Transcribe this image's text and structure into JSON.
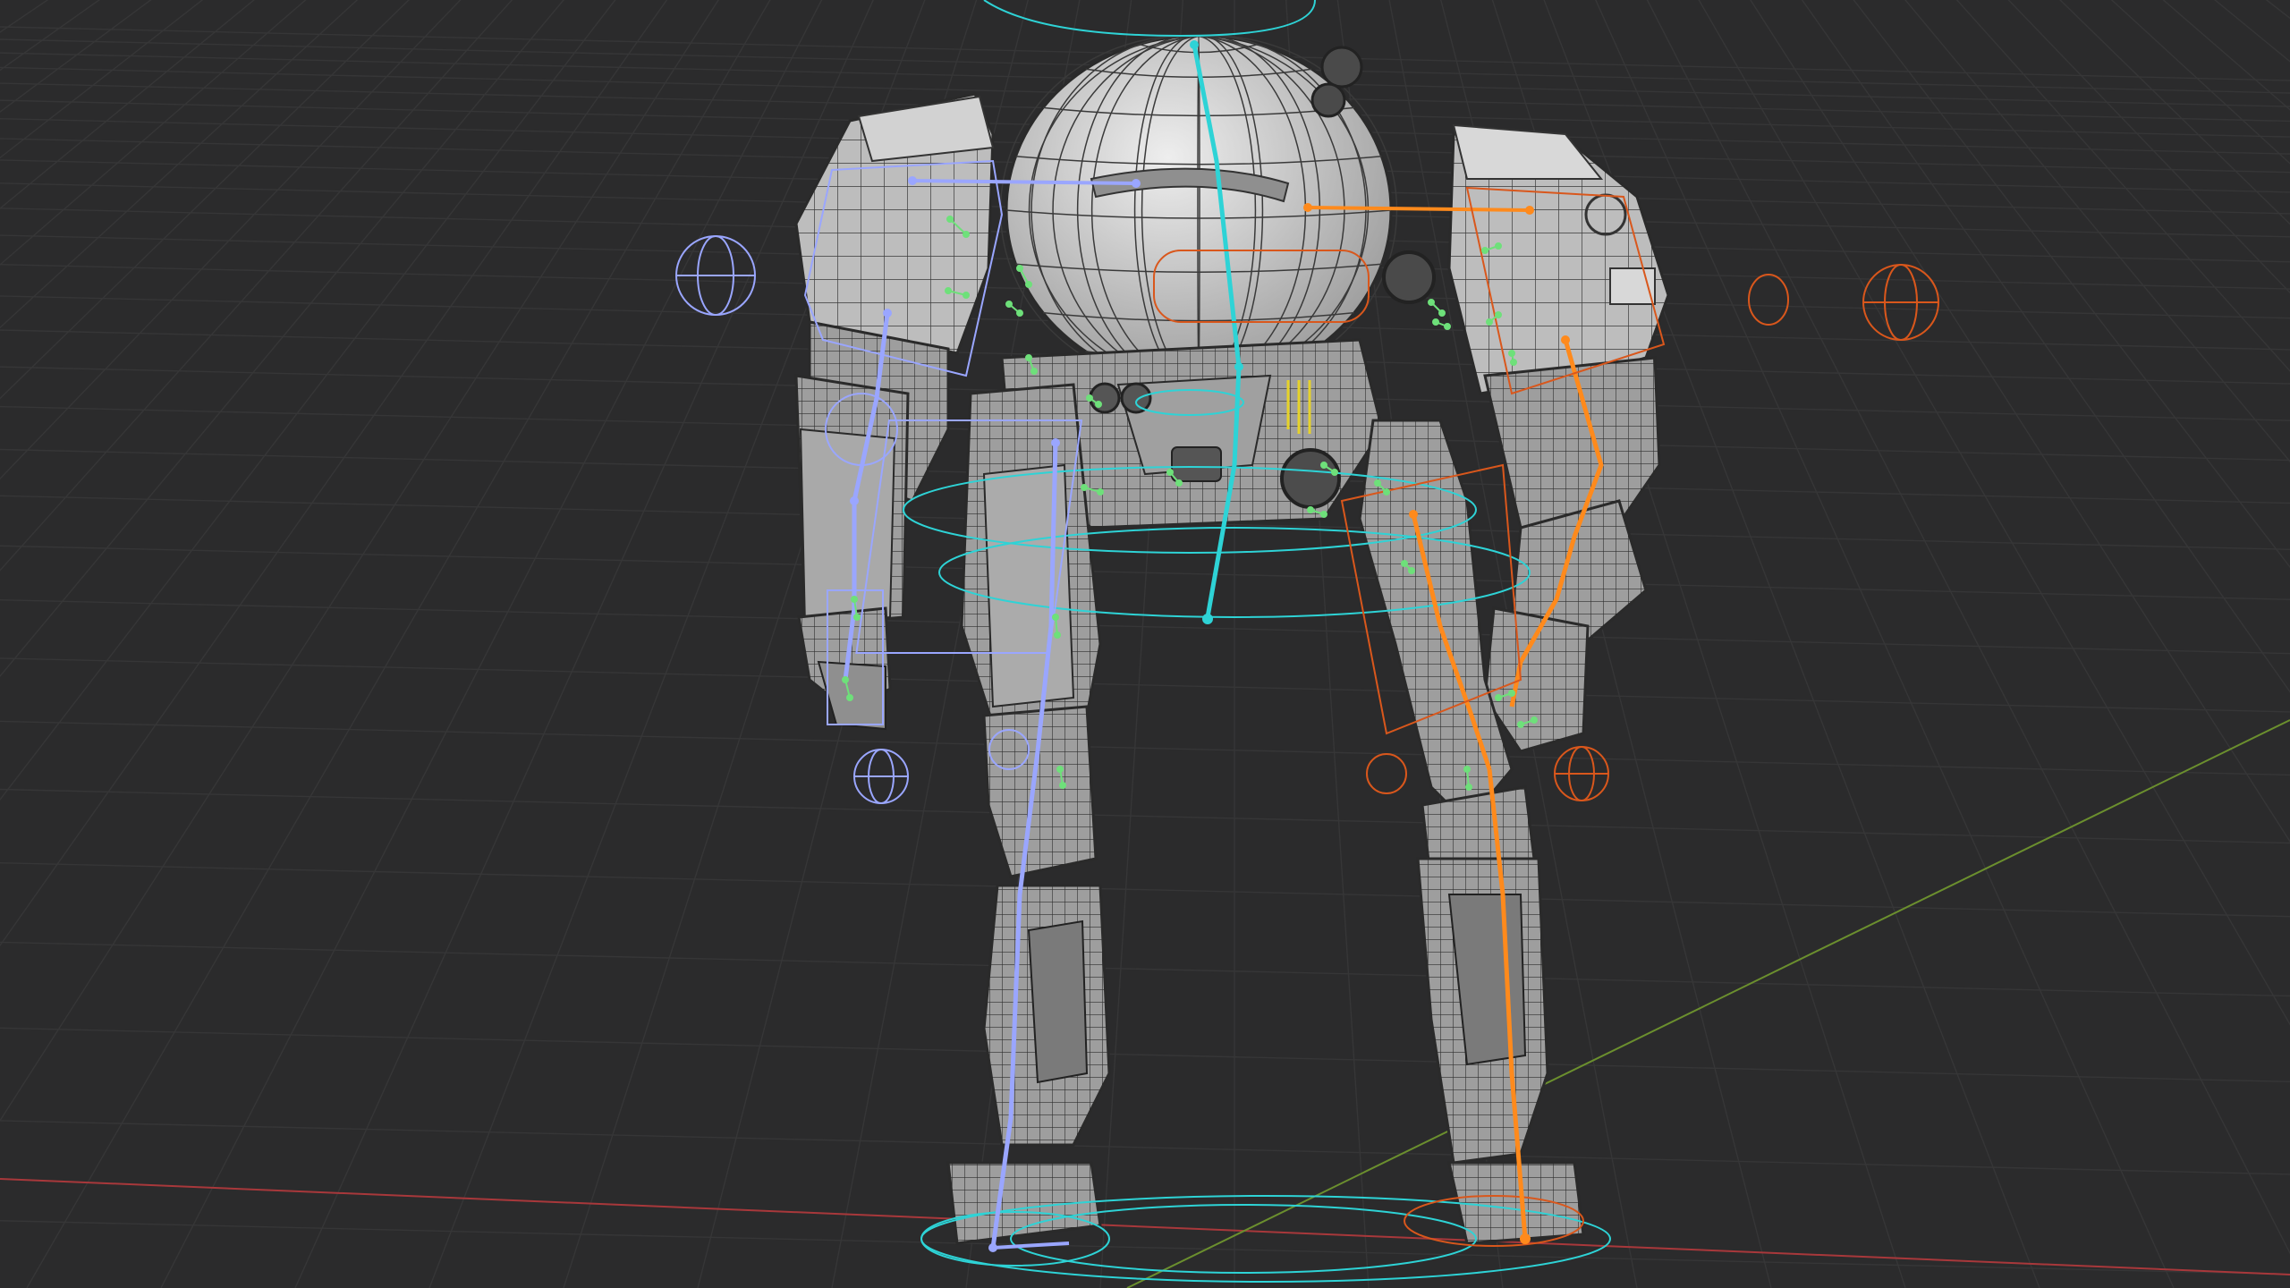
{
  "viewport": {
    "mode": "3d-viewport",
    "background": "#2b2b2c",
    "grid_color": "#363637",
    "x_axis_color": "#a8383b",
    "y_axis_color": "#6b8f2e"
  },
  "armature": {
    "spine_color": "#2ed3d6",
    "left_side_color": "#9aa6ff",
    "right_side_color": "#ff8a1c",
    "right_control_color": "#d9571c",
    "bone_tip_color": "#6ee07a"
  },
  "model": {
    "mesh_fill": "#b8b8b8",
    "wire_color": "#2c2c2c"
  }
}
